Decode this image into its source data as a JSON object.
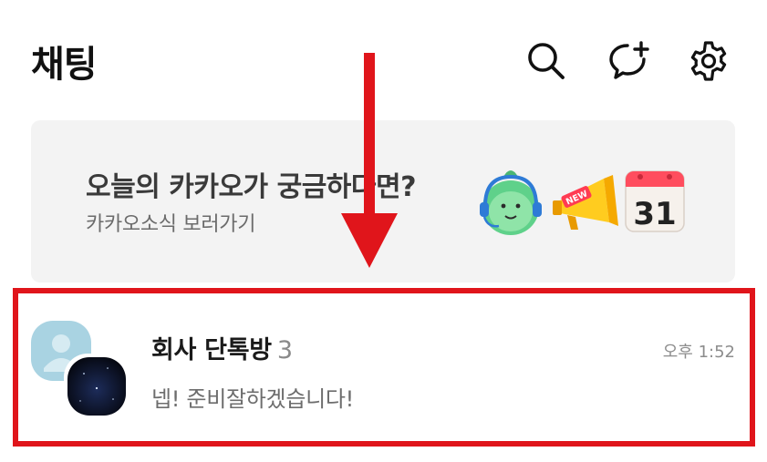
{
  "header": {
    "title": "채팅",
    "icons": [
      "search-icon",
      "new-chat-icon",
      "settings-icon"
    ]
  },
  "banner": {
    "title": "오늘의 카카오가 궁금하다면?",
    "subtitle": "카카오소식 보러가기",
    "megaphone_badge": "NEW",
    "calendar_day": "31"
  },
  "chats": [
    {
      "name": "회사 단톡방",
      "member_count": "3",
      "time": "오후 1:52",
      "preview": "넵! 준비잘하겠습니다!"
    }
  ],
  "colors": {
    "accent_red": "#e0151b",
    "banner_bg": "#f3f3f3"
  }
}
